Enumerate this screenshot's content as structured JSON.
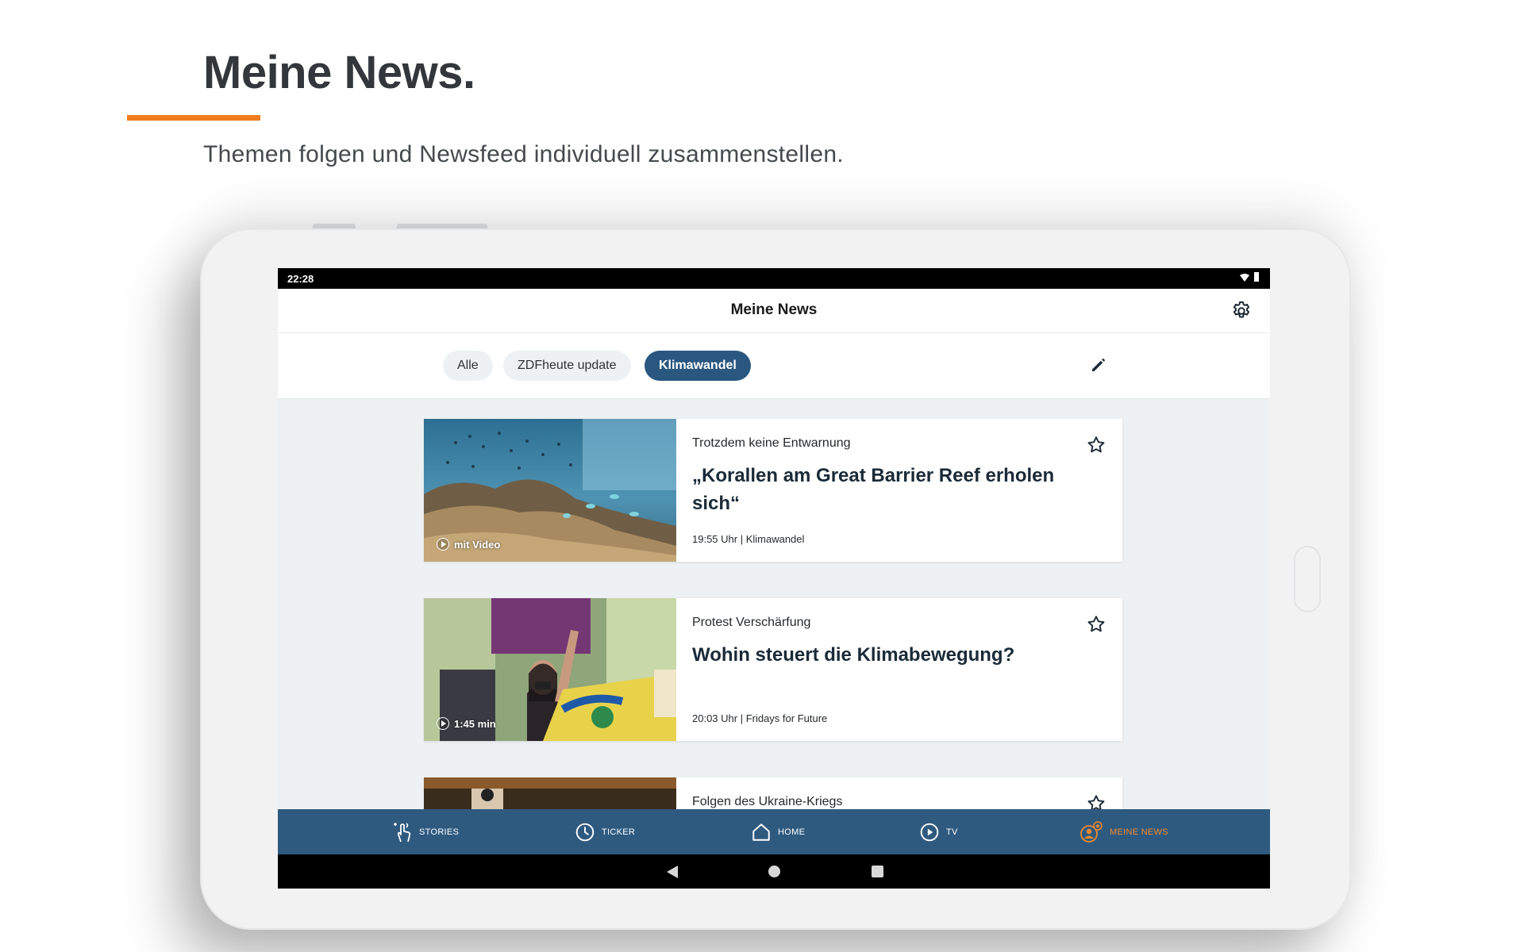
{
  "promo": {
    "title": "Meine News.",
    "subtitle": "Themen folgen und Newsfeed individuell zusammenstellen.",
    "accent_color": "#f07d1e"
  },
  "status_bar": {
    "time": "22:28",
    "icons": [
      "wifi-icon",
      "battery-icon"
    ]
  },
  "app_bar": {
    "title": "Meine News",
    "settings_icon": "gear-icon"
  },
  "chips": {
    "all": "Alle",
    "update": "ZDFheute update",
    "klima": "Klimawandel",
    "selected": "Klimawandel",
    "edit_icon": "pencil-icon"
  },
  "cards": [
    {
      "kicker": "Trotzdem keine Entwarnung",
      "headline": "„Korallen am Great Barrier Reef erholen sich“",
      "meta": "19:55 Uhr | Klimawandel",
      "badge": "mit Video"
    },
    {
      "kicker": "Protest Verschärfung",
      "headline": "Wohin steuert die Klimabewegung?",
      "meta": "20:03 Uhr | Fridays for Future",
      "badge": "1:45 min"
    },
    {
      "kicker": "Folgen des Ukraine-Kriegs"
    }
  ],
  "bottom_nav": {
    "stories": "STORIES",
    "ticker": "TICKER",
    "home": "HOME",
    "tv": "TV",
    "meine_news": "MEINE NEWS",
    "active": "MEINE NEWS",
    "bar_color": "#2f5a80",
    "active_color": "#f08a2c"
  },
  "colors": {
    "chip_selected": "#2a5780",
    "feed_background": "#eef1f4"
  }
}
